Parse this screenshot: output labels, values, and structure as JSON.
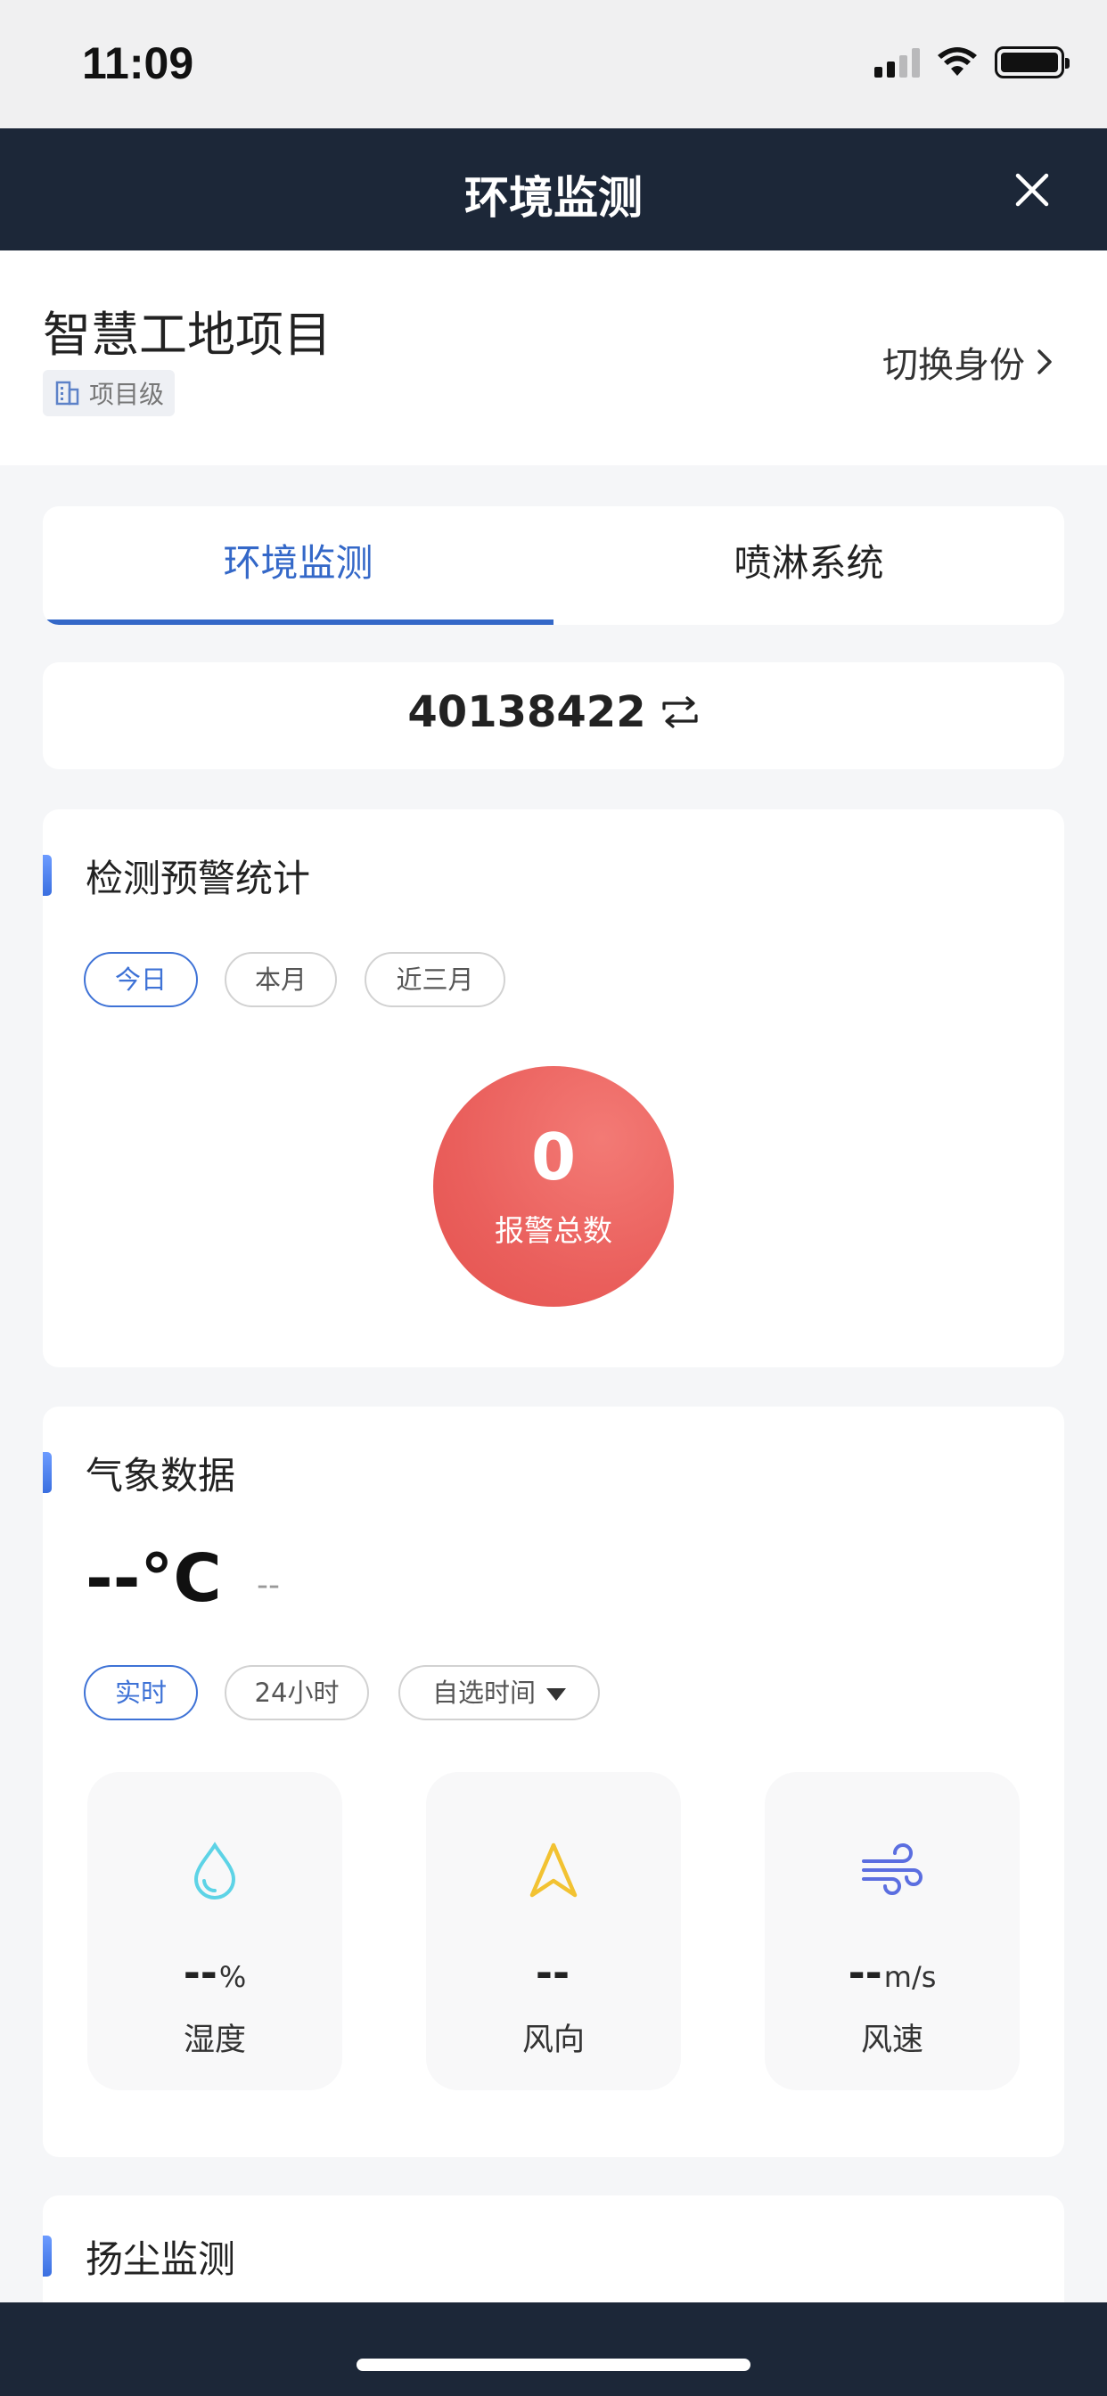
{
  "status_bar": {
    "time": "11:09"
  },
  "nav": {
    "title": "环境监测",
    "close_icon": "close-icon"
  },
  "project": {
    "name": "智慧工地项目",
    "level": "项目级",
    "switch_role": "切换身份"
  },
  "tabs": [
    {
      "label": "环境监测",
      "active": true
    },
    {
      "label": "喷淋系统",
      "active": false
    }
  ],
  "device": {
    "id": "40138422",
    "switch_icon": "swap-icon"
  },
  "alarm_stats": {
    "title": "检测预警统计",
    "filters": [
      "今日",
      "本月",
      "近三月"
    ],
    "selected_filter": "今日",
    "count": "0",
    "count_label": "报警总数"
  },
  "weather": {
    "title": "气象数据",
    "temperature": "--°C",
    "condition": "--",
    "filters": [
      "实时",
      "24小时",
      "自选时间"
    ],
    "selected_filter": "实时",
    "metrics": [
      {
        "icon": "droplet-icon",
        "value": "--",
        "unit": "%",
        "label": "湿度",
        "color": "#5dd3e6"
      },
      {
        "icon": "navigation-arrow-icon",
        "value": "--",
        "unit": "",
        "label": "风向",
        "color": "#f2c232"
      },
      {
        "icon": "wind-icon",
        "value": "--",
        "unit": "m/s",
        "label": "风速",
        "color": "#5b6ee0"
      }
    ]
  },
  "dust": {
    "title": "扬尘监测"
  },
  "colors": {
    "nav_bg": "#1c2738",
    "accent": "#3468c8",
    "alarm": "#ea5f5c"
  }
}
